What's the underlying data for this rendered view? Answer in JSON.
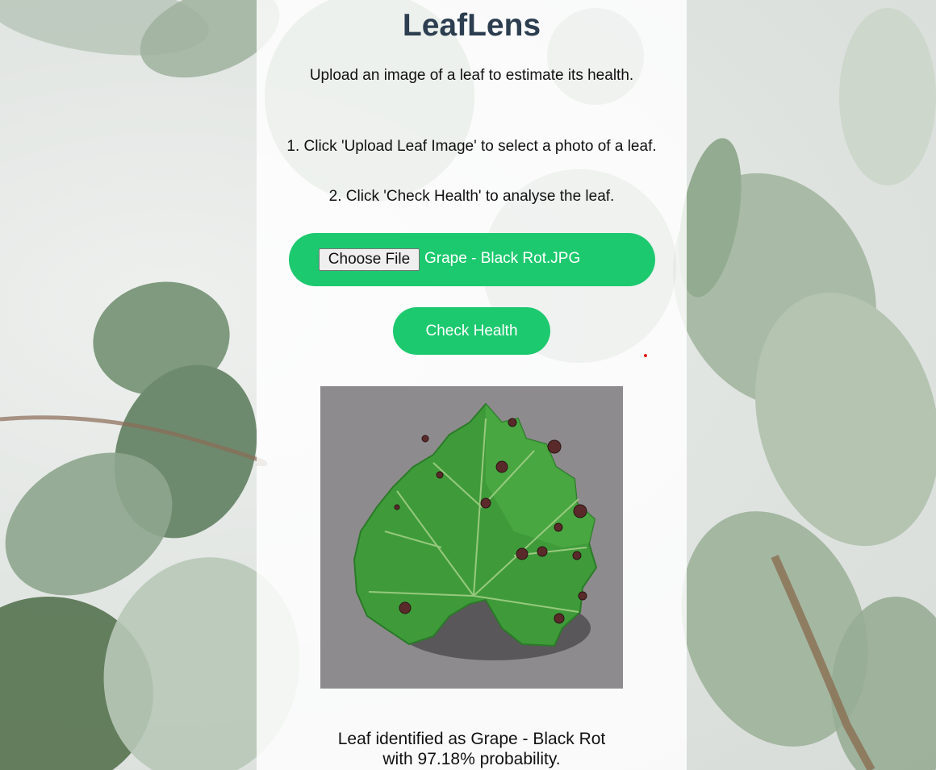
{
  "app": {
    "title": "LeafLens",
    "subtitle": "Upload an image of a leaf to estimate its health."
  },
  "instructions": [
    "1. Click 'Upload Leaf Image' to select a photo of a leaf.",
    "2. Click 'Check Health' to analyse the leaf."
  ],
  "upload": {
    "choose_file_label": "Choose File",
    "file_name": "Grape - Black Rot.JPG"
  },
  "check_button": {
    "label": "Check Health"
  },
  "result": {
    "line1": "Leaf identified as Grape - Black Rot",
    "line2": "with 97.18% probability."
  },
  "colors": {
    "accent_green": "#1dc96f",
    "title_color": "#2c3e50"
  },
  "icons": {
    "background": "eucalyptus-leaves-photo",
    "preview": "grape-leaf-photo"
  }
}
